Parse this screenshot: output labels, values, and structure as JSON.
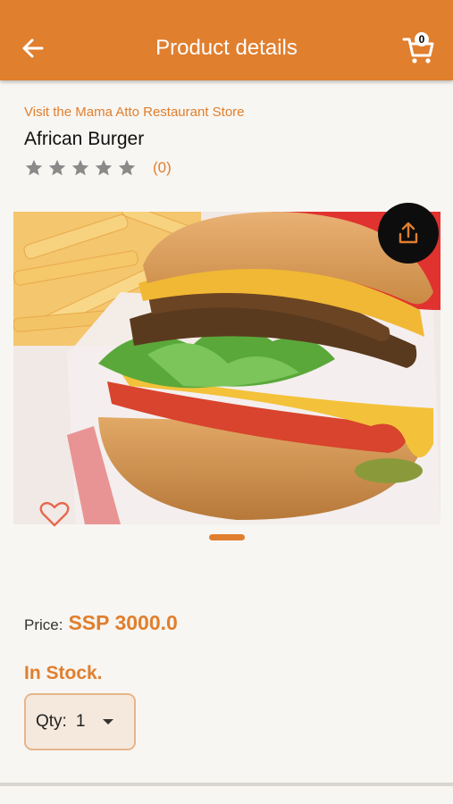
{
  "header": {
    "title": "Product details",
    "cart_count": "0"
  },
  "product": {
    "store_link": "Visit the Mama Atto Restaurant  Store",
    "name": "African Burger",
    "rating_count": "(0)",
    "stars_filled": 0,
    "stars_total": 5
  },
  "pricing": {
    "label": "Price:",
    "value": "SSP 3000.0"
  },
  "stock": {
    "status": "In Stock."
  },
  "quantity": {
    "label": "Qty:",
    "value": "1"
  },
  "colors": {
    "accent": "#e07f2e",
    "background": "#f8f6f2",
    "star_empty": "#8a8a8a"
  },
  "icons": [
    "back-arrow-icon",
    "cart-icon",
    "star-icon",
    "share-icon",
    "heart-icon",
    "chevron-down-icon"
  ]
}
